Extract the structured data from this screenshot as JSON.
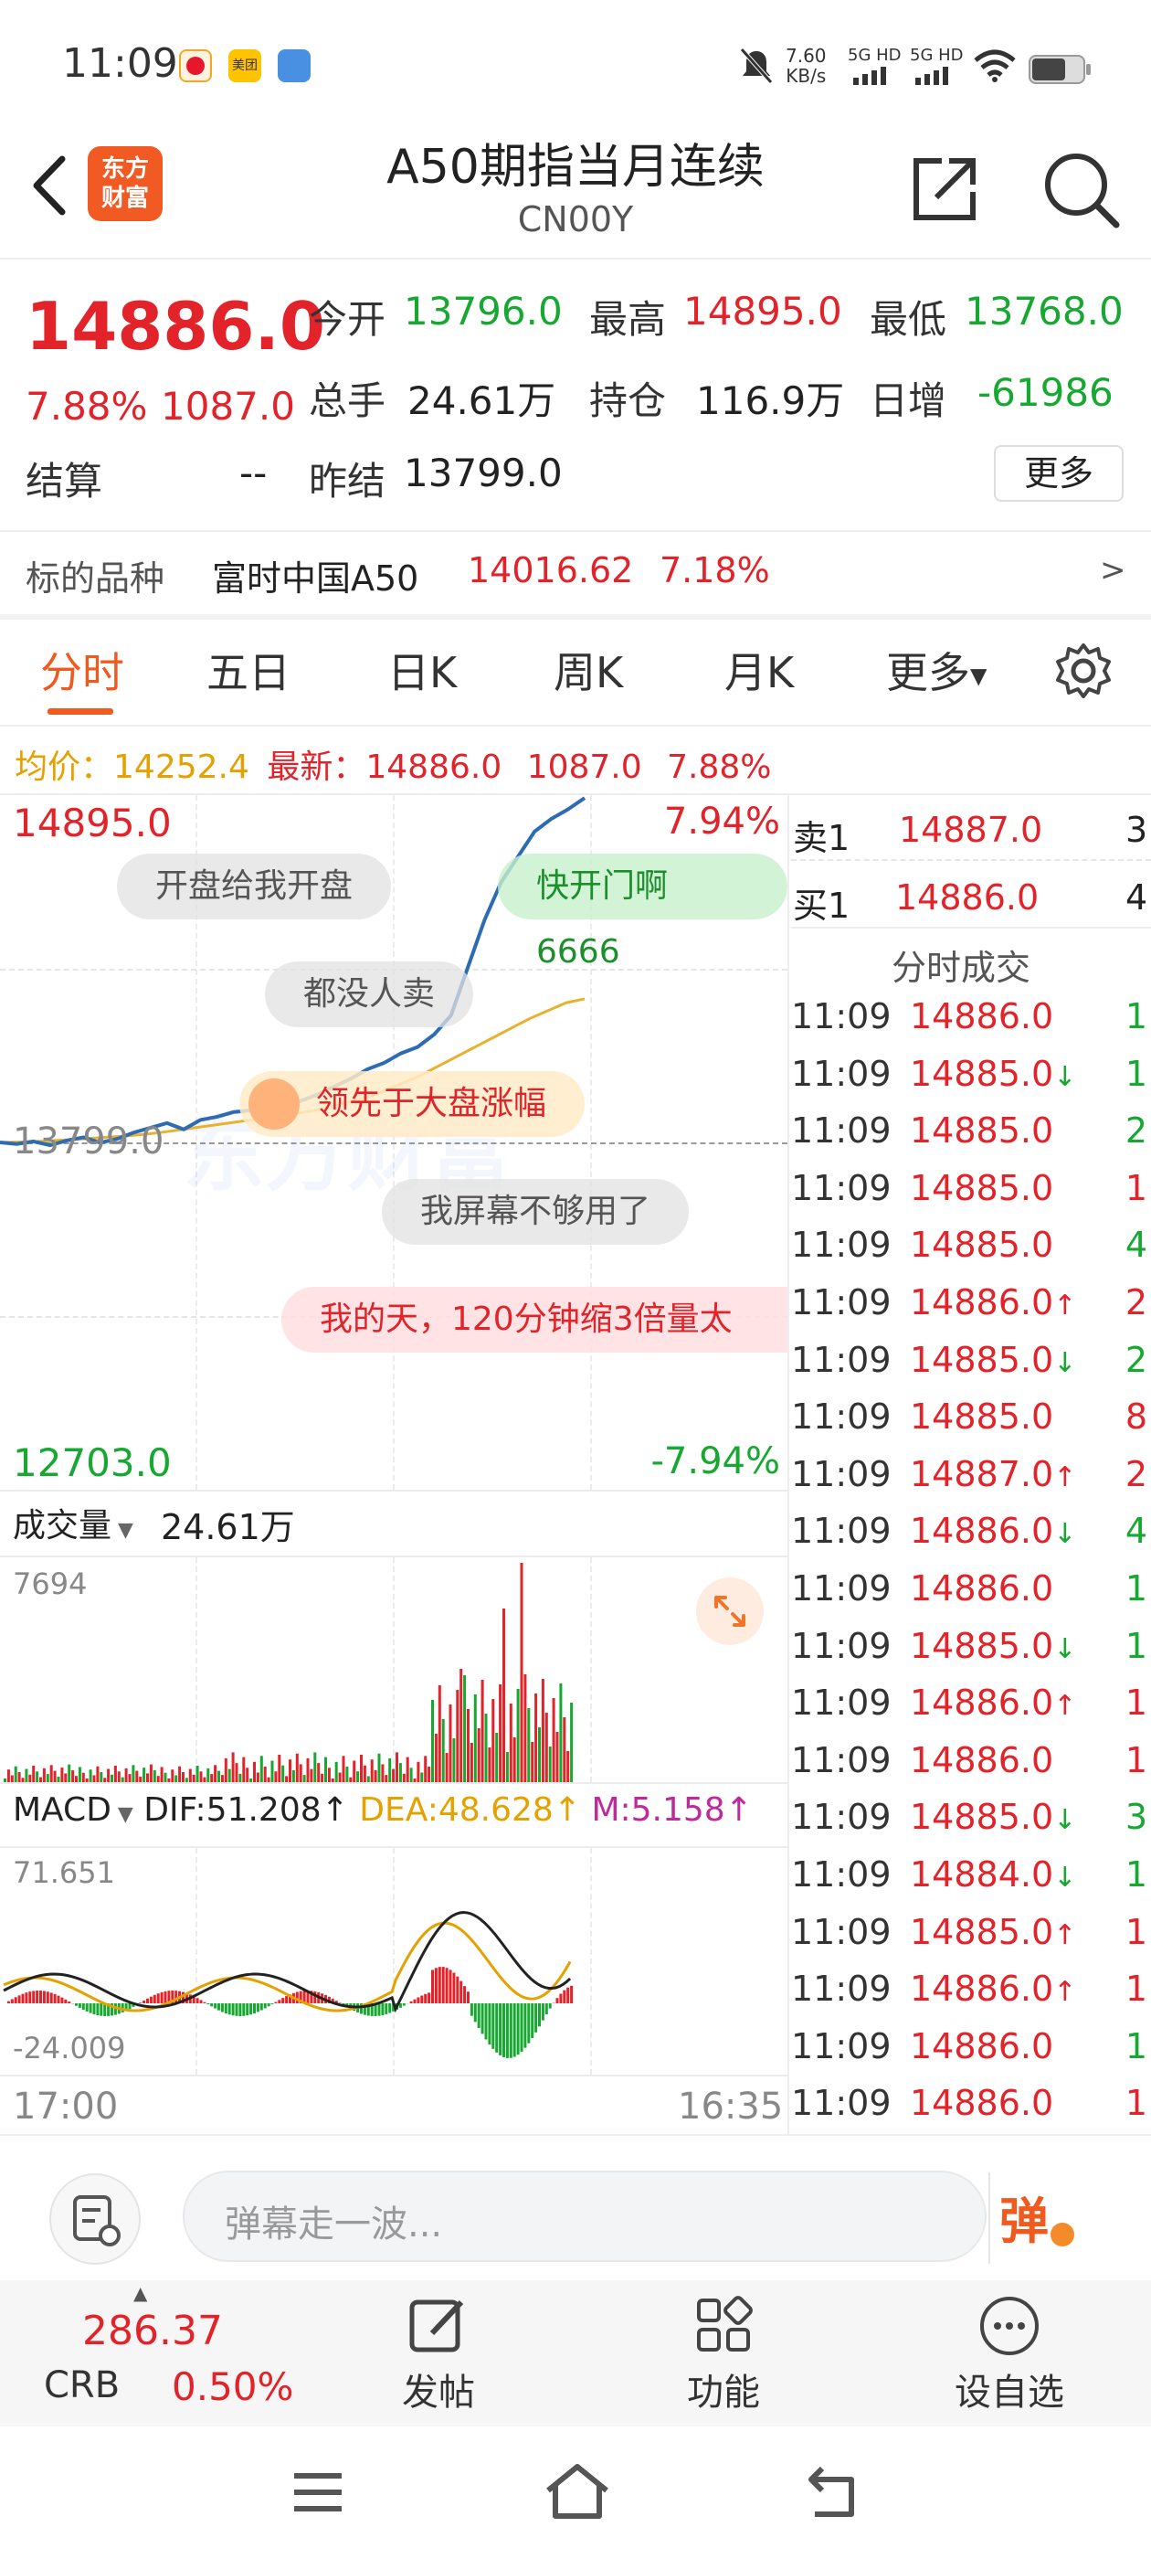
{
  "status_bar": {
    "time": "11:09",
    "speed_value": "7.60",
    "speed_unit": "KB/s",
    "sim1": "5G HD",
    "sim2": "5G HD",
    "app_icons": [
      "weibo-icon",
      "meituan-icon",
      "app-icon"
    ]
  },
  "header": {
    "logo_line1": "东方",
    "logo_line2": "财富",
    "title": "A50期指当月连续",
    "code": "CN00Y"
  },
  "quote": {
    "last_price": "14886.0",
    "change_pct": "7.88%",
    "change": "1087.0",
    "open_label": "今开",
    "open": "13796.0",
    "high_label": "最高",
    "high": "14895.0",
    "low_label": "最低",
    "low": "13768.0",
    "volume_label": "总手",
    "volume": "24.61万",
    "oi_label": "持仓",
    "oi": "116.9万",
    "daily_inc_label": "日增",
    "daily_inc": "-61986",
    "settle_label": "结算",
    "settle": "--",
    "prev_settle_label": "昨结",
    "prev_settle": "13799.0",
    "more_label": "更多"
  },
  "underlying": {
    "label": "标的品种",
    "name": "富时中国A50",
    "price": "14016.62",
    "pct": "7.18%",
    "arrow": ">"
  },
  "tabs": [
    "分时",
    "五日",
    "日K",
    "周K",
    "月K",
    "更多"
  ],
  "avg_bar": {
    "avg_label": "均价：",
    "avg": "14252.4",
    "latest_label": "最新：",
    "latest": "14886.0",
    "change": "1087.0",
    "pct": "7.88%"
  },
  "intraday": {
    "y_top": "14895.0",
    "y_top_pct": "7.94%",
    "y_mid": "13799.0",
    "y_bottom": "12703.0",
    "y_bottom_pct": "-7.94%",
    "price_series": [
      13799,
      13794,
      13802,
      13790,
      13805,
      13815,
      13798,
      13810,
      13830,
      13845,
      13860,
      13840,
      13870,
      13880,
      13895,
      13900,
      13920,
      13905,
      13930,
      13950,
      13975,
      14000,
      14030,
      14050,
      14080,
      14100,
      14140,
      14200,
      14350,
      14500,
      14620,
      14700,
      14780,
      14820,
      14850,
      14886
    ],
    "avg_series": [
      13799,
      13800,
      13802,
      13805,
      13808,
      13812,
      13816,
      13820,
      13825,
      13832,
      13840,
      13848,
      13856,
      13864,
      13872,
      13880,
      13888,
      13898,
      13910,
      13925,
      13940,
      13960,
      13985,
      14010,
      14040,
      14070,
      14100,
      14130,
      14160,
      14190,
      14215,
      14240,
      14252
    ],
    "watermark": "东方财富"
  },
  "danmaku": [
    "开盘给我开盘",
    "快开门啊6666",
    "都没人卖",
    "领先于大盘涨幅",
    "我屏幕不够用了",
    "我的天，120分钟缩3倍量太"
  ],
  "volume_panel": {
    "label": "成交量",
    "total": "24.61万",
    "max": "7694"
  },
  "macd_panel": {
    "label": "MACD",
    "dif": "DIF:51.208",
    "dea": "DEA:48.628",
    "m": "M:5.158",
    "top": "71.651",
    "bottom": "-24.009"
  },
  "time_axis": {
    "start": "17:00",
    "end": "16:35"
  },
  "order_book": {
    "ask_label": "卖1",
    "ask_price": "14887.0",
    "ask_vol": "3",
    "bid_label": "买1",
    "bid_price": "14886.0",
    "bid_vol": "4",
    "ticks_title": "分时成交"
  },
  "ticks": [
    {
      "time": "11:09",
      "price": "14886.0",
      "dir": "",
      "vol": "1"
    },
    {
      "time": "11:09",
      "price": "14885.0",
      "dir": "↓",
      "vol": "1"
    },
    {
      "time": "11:09",
      "price": "14885.0",
      "dir": "",
      "vol": "2"
    },
    {
      "time": "11:09",
      "price": "14885.0",
      "dir": "",
      "vol": "1"
    },
    {
      "time": "11:09",
      "price": "14885.0",
      "dir": "",
      "vol": "4"
    },
    {
      "time": "11:09",
      "price": "14886.0",
      "dir": "↑",
      "vol": "2"
    },
    {
      "time": "11:09",
      "price": "14885.0",
      "dir": "↓",
      "vol": "2"
    },
    {
      "time": "11:09",
      "price": "14885.0",
      "dir": "",
      "vol": "8"
    },
    {
      "time": "11:09",
      "price": "14887.0",
      "dir": "↑",
      "vol": "2"
    },
    {
      "time": "11:09",
      "price": "14886.0",
      "dir": "↓",
      "vol": "4"
    },
    {
      "time": "11:09",
      "price": "14886.0",
      "dir": "",
      "vol": "1"
    },
    {
      "time": "11:09",
      "price": "14885.0",
      "dir": "↓",
      "vol": "1"
    },
    {
      "time": "11:09",
      "price": "14886.0",
      "dir": "↑",
      "vol": "1"
    },
    {
      "time": "11:09",
      "price": "14886.0",
      "dir": "",
      "vol": "1"
    },
    {
      "time": "11:09",
      "price": "14885.0",
      "dir": "↓",
      "vol": "3"
    },
    {
      "time": "11:09",
      "price": "14884.0",
      "dir": "↓",
      "vol": "1"
    },
    {
      "time": "11:09",
      "price": "14885.0",
      "dir": "↑",
      "vol": "1"
    },
    {
      "time": "11:09",
      "price": "14886.0",
      "dir": "↑",
      "vol": "1"
    },
    {
      "time": "11:09",
      "price": "14886.0",
      "dir": "",
      "vol": "1"
    },
    {
      "time": "11:09",
      "price": "14886.0",
      "dir": "",
      "vol": "1"
    }
  ],
  "comment_bar": {
    "placeholder": "弹幕走一波...",
    "danmu_btn": "弹"
  },
  "toolbar": {
    "crb_value": "286.37",
    "crb_label": "CRB",
    "crb_pct": "0.50%",
    "post": "发帖",
    "function": "功能",
    "watchlist": "设自选"
  }
}
